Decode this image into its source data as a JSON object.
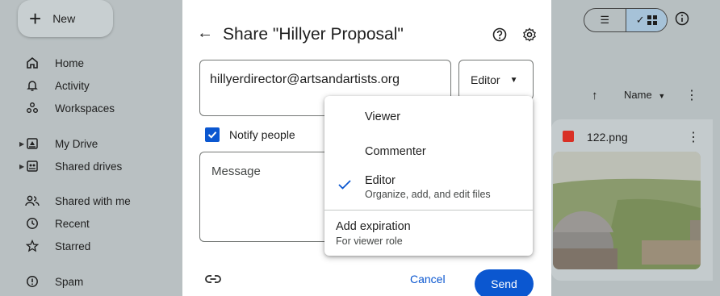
{
  "sidebar": {
    "new_label": "New",
    "items": [
      {
        "label": "Home",
        "icon": "home-icon"
      },
      {
        "label": "Activity",
        "icon": "bell-icon"
      },
      {
        "label": "Workspaces",
        "icon": "workspaces-icon"
      },
      {
        "label": "My Drive",
        "icon": "drive-icon"
      },
      {
        "label": "Shared drives",
        "icon": "shared-drives-icon"
      },
      {
        "label": "Shared with me",
        "icon": "people-icon"
      },
      {
        "label": "Recent",
        "icon": "clock-icon"
      },
      {
        "label": "Starred",
        "icon": "star-icon"
      },
      {
        "label": "Spam",
        "icon": "spam-icon"
      }
    ]
  },
  "file_list": {
    "sort_label": "Name",
    "file_name": "122.png"
  },
  "dialog": {
    "title": "Share \"Hillyer Proposal\"",
    "email_value": "hillyerdirector@artsandartists.org",
    "role_value": "Editor",
    "notify_label": "Notify people",
    "message_placeholder": "Message",
    "cancel_label": "Cancel",
    "send_label": "Send"
  },
  "role_menu": {
    "options": [
      {
        "label": "Viewer",
        "description": ""
      },
      {
        "label": "Commenter",
        "description": ""
      },
      {
        "label": "Editor",
        "description": "Organize, add, and edit files",
        "selected": true
      }
    ],
    "expiration_label": "Add expiration",
    "expiration_desc": "For viewer role"
  },
  "colors": {
    "primary": "#0b57d0",
    "overlay": "#b7bfc1"
  }
}
